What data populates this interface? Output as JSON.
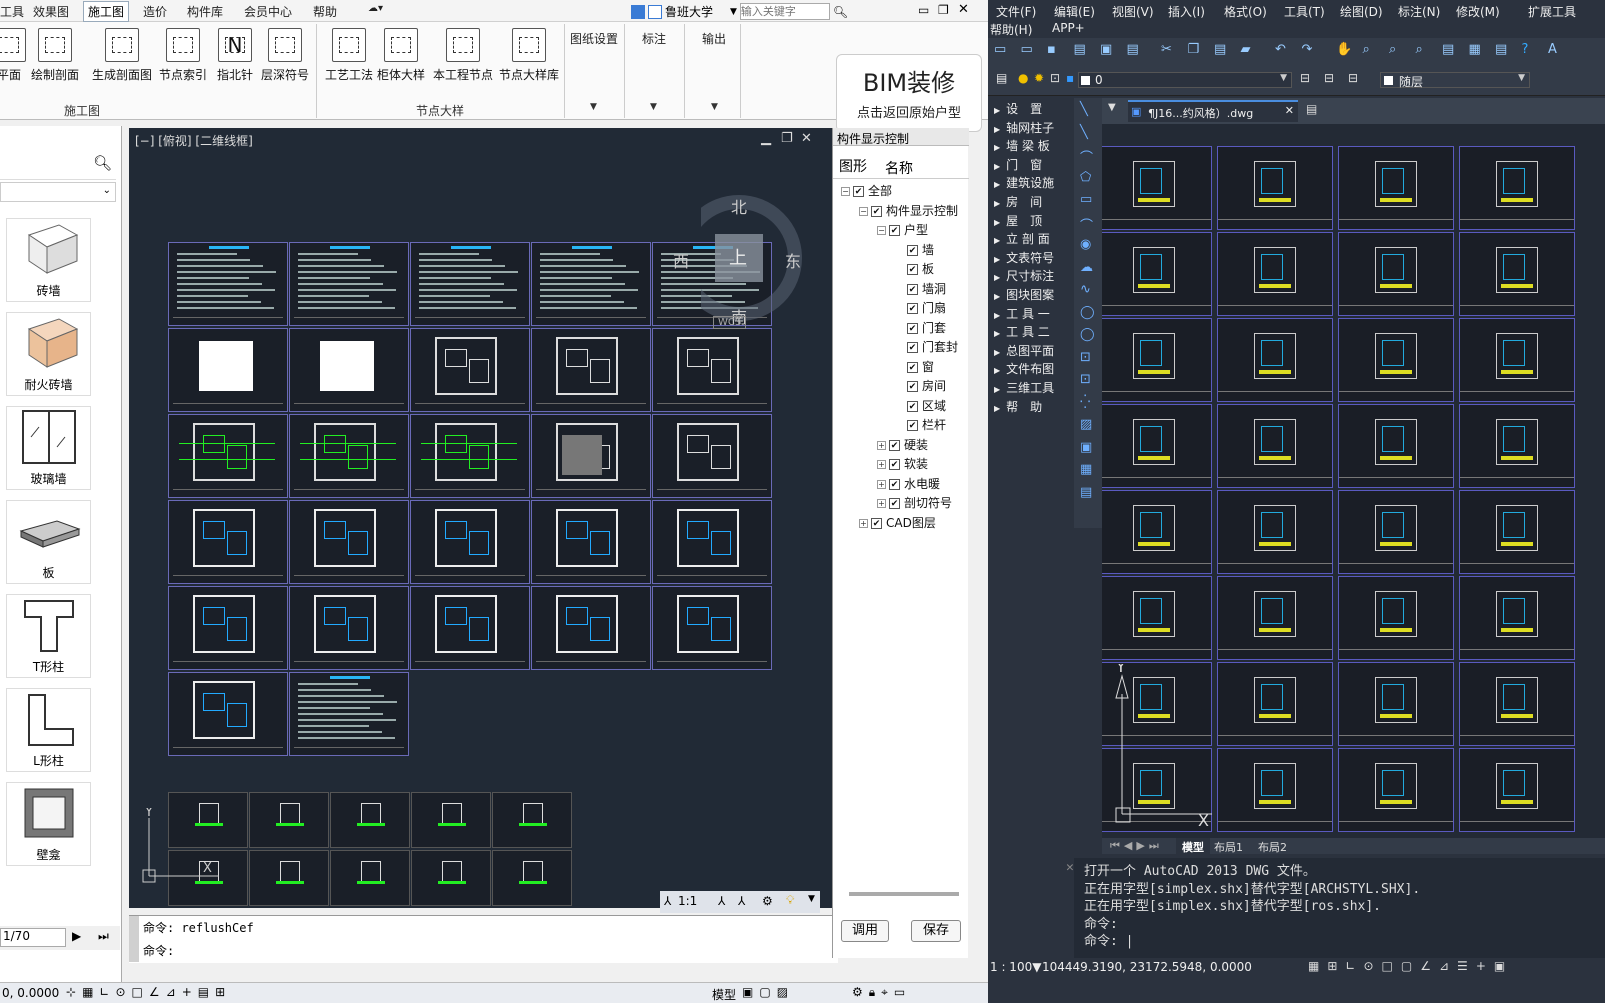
{
  "left_menu": [
    "工具",
    "效果图",
    "施工图",
    "造价",
    "构件库",
    "会员中心",
    "帮助"
  ],
  "left_active_menu": "施工图",
  "search": {
    "school": "鲁班大学",
    "placeholder": "输入关键字"
  },
  "ribbon": {
    "buttons_g1": [
      "平面",
      "绘制剖面",
      "生成剖面图",
      "节点索引",
      "指北针",
      "层深符号"
    ],
    "group1_label": "施工图",
    "buttons_g2": [
      "工艺工法",
      "柜体大样",
      "本工程节点",
      "节点大样库"
    ],
    "group2_label": "节点大样",
    "small": [
      "图纸设置",
      "标注",
      "输出"
    ]
  },
  "bim": {
    "title": "BIM装修",
    "subtitle": "点击返回原始户型"
  },
  "palette_items": [
    "砖墙",
    "耐火砖墙",
    "玻璃墙",
    "板",
    "T形柱",
    "L形柱",
    "壁龛"
  ],
  "viewport": {
    "title": "[−] [俯视] [二维线框]",
    "compass": {
      "n": "北",
      "s": "南",
      "e": "东",
      "w": "西",
      "center": "上",
      "wcs": "WCS"
    },
    "scale": "1:1"
  },
  "left_cmd": {
    "line1": "命令: reflushCef",
    "line2": "命令:"
  },
  "page_control": "1/70",
  "left_status": {
    "coord": "0, 0.0000",
    "model": "模型"
  },
  "comp_panel": {
    "title": "构件显示控制",
    "tabs": [
      "图形",
      "名称"
    ],
    "tree": [
      {
        "label": "全部",
        "level": 0,
        "exp": "−"
      },
      {
        "label": "构件显示控制",
        "level": 1,
        "exp": "−"
      },
      {
        "label": "户型",
        "level": 2,
        "exp": "−"
      },
      {
        "label": "墙",
        "level": 3,
        "exp": ""
      },
      {
        "label": "板",
        "level": 3,
        "exp": ""
      },
      {
        "label": "墙洞",
        "level": 3,
        "exp": ""
      },
      {
        "label": "门扇",
        "level": 3,
        "exp": ""
      },
      {
        "label": "门套",
        "level": 3,
        "exp": ""
      },
      {
        "label": "门套封",
        "level": 3,
        "exp": ""
      },
      {
        "label": "窗",
        "level": 3,
        "exp": ""
      },
      {
        "label": "房间",
        "level": 3,
        "exp": ""
      },
      {
        "label": "区域",
        "level": 3,
        "exp": ""
      },
      {
        "label": "栏杆",
        "level": 3,
        "exp": ""
      },
      {
        "label": "硬装",
        "level": 2,
        "exp": "+"
      },
      {
        "label": "软装",
        "level": 2,
        "exp": "+"
      },
      {
        "label": "水电暖",
        "level": 2,
        "exp": "+"
      },
      {
        "label": "剖切符号",
        "level": 2,
        "exp": "+"
      },
      {
        "label": "CAD图层",
        "level": 1,
        "exp": "+"
      }
    ],
    "btn_apply": "调用",
    "btn_save": "保存"
  },
  "right_menu_row1": [
    "文件(F)",
    "编辑(E)",
    "视图(V)",
    "插入(I)",
    "格式(O)",
    "工具(T)",
    "绘图(D)",
    "标注(N)",
    "修改(M)",
    "扩展工具"
  ],
  "right_menu_row2": [
    "帮助(H)",
    "APP+"
  ],
  "layer": {
    "name": "0",
    "linetype": "随层"
  },
  "right_left_menu": [
    "设　置",
    "轴网柱子",
    "墙 梁 板",
    "门　窗",
    "建筑设施",
    "房　间",
    "屋　顶",
    "立 剖 面",
    "文表符号",
    "尺寸标注",
    "图块图案",
    "工 具 一",
    "工 具 二",
    "总图平面",
    "文件布图",
    "三维工具",
    "帮　助"
  ],
  "file_tab": "¶J16...约风格）.dwg",
  "layout_tabs": [
    "模型",
    "布局1",
    "布局2"
  ],
  "right_cmd": [
    "打开一个 AutoCAD 2013 DWG 文件。",
    "正在用字型[simplex.shx]替代字型[ARCHSTYL.SHX].",
    "正在用字型[simplex.shx]替代字型[ros.shx].",
    "命令:",
    "命令: |"
  ],
  "right_status": {
    "scale": "1 : 100▼",
    "coords": "104449.3190, 23172.5948, 0.0000"
  },
  "colors": {
    "dark_bg": "#212a36",
    "cad_bg": "#232a35",
    "accent_blue": "#1a73c8",
    "sheet_border": "#6a6ab8"
  }
}
